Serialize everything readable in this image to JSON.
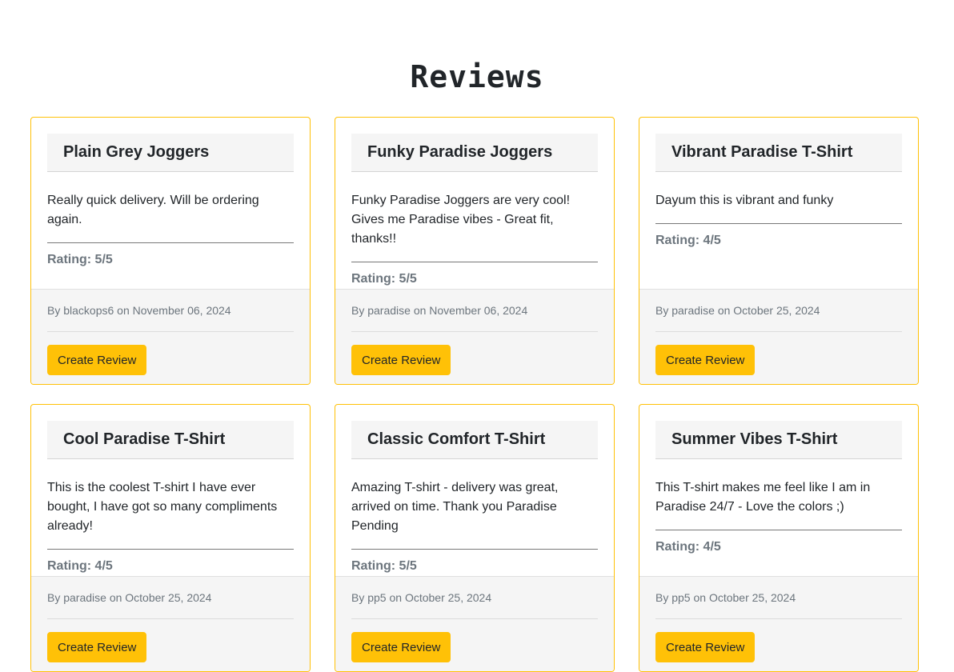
{
  "page": {
    "title": "Reviews"
  },
  "theme": {
    "accent": "#ffc107",
    "muted_text": "#6c757d",
    "header_bg": "#f5f5f5"
  },
  "reviews": [
    {
      "product": "Plain Grey Joggers",
      "text": "Really quick delivery. Will be ordering again.",
      "rating": "Rating: 5/5",
      "meta": "By blackops6 on November 06, 2024",
      "button": "Create Review"
    },
    {
      "product": "Funky Paradise Joggers",
      "text": "Funky Paradise Joggers are very cool! Gives me Paradise vibes - Great fit, thanks!!",
      "rating": "Rating: 5/5",
      "meta": "By paradise on November 06, 2024",
      "button": "Create Review"
    },
    {
      "product": "Vibrant Paradise T-Shirt",
      "text": "Dayum this is vibrant and funky",
      "rating": "Rating: 4/5",
      "meta": "By paradise on October 25, 2024",
      "button": "Create Review"
    },
    {
      "product": "Cool Paradise T-Shirt",
      "text": "This is the coolest T-shirt I have ever bought, I have got so many compliments already!",
      "rating": "Rating: 4/5",
      "meta": "By paradise on October 25, 2024",
      "button": "Create Review"
    },
    {
      "product": "Classic Comfort T-Shirt",
      "text": "Amazing T-shirt - delivery was great, arrived on time. Thank you Paradise Pending",
      "rating": "Rating: 5/5",
      "meta": "By pp5 on October 25, 2024",
      "button": "Create Review"
    },
    {
      "product": "Summer Vibes T-Shirt",
      "text": "This T-shirt makes me feel like I am in Paradise 24/7 - Love the colors ;)",
      "rating": "Rating: 4/5",
      "meta": "By pp5 on October 25, 2024",
      "button": "Create Review"
    }
  ]
}
